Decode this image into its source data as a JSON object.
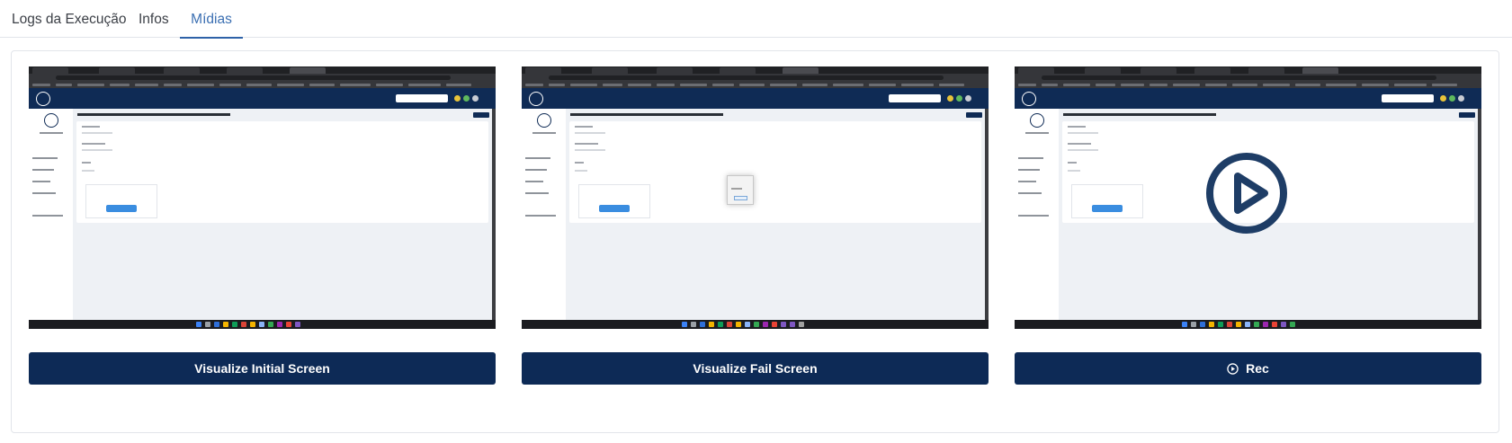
{
  "tabs": [
    {
      "label": "Logs da Execução",
      "active": false
    },
    {
      "label": "Infos",
      "active": false
    },
    {
      "label": "Mídias",
      "active": true
    }
  ],
  "media": {
    "initial_button": "Visualize Initial Screen",
    "fail_button": "Visualize Fail Screen",
    "rec_button": "Rec",
    "rec_button_icon": "play-circle-icon",
    "video_thumb_icon": "play-circle-icon"
  },
  "colors": {
    "accent": "#2e62a8",
    "button_bg": "#0d2a56",
    "play_icon": "#1e3d66"
  }
}
